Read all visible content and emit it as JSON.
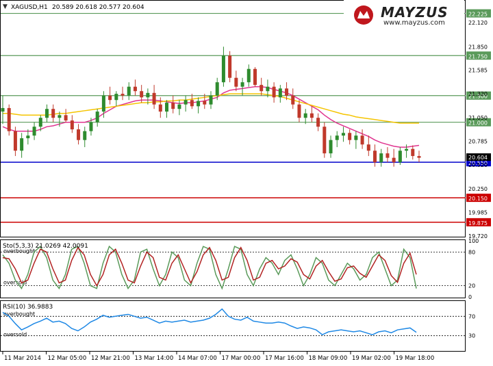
{
  "symbol_header": {
    "symbol": "XAGUSD,H1",
    "ohlc": "20.589 20.618 20.577 20.604"
  },
  "logo": {
    "brand": "MAYZUS",
    "url": "www.mayzus.com"
  },
  "colors": {
    "bull_candle": "#2e8b2e",
    "bear_candle": "#c0392b",
    "sma_fast": "#e0338f",
    "sma_slow": "#f5c400",
    "level_green": "#5a9a5a",
    "level_red": "#cc0000",
    "current_blue": "#0000cc",
    "stoch_main": "#5a9a5a",
    "stoch_signal": "#b22222",
    "rsi": "#1e88e5"
  },
  "chart_data": [
    {
      "type": "candlestick",
      "symbol": "XAGUSD",
      "timeframe": "H1",
      "ylim": [
        19.72,
        22.36
      ],
      "y_ticks": [
        "22.120",
        "21.850",
        "21.585",
        "21.320",
        "21.050",
        "20.785",
        "20.520",
        "20.250",
        "19.985",
        "19.720"
      ],
      "x_ticks": [
        "11 Mar 2014",
        "12 Mar 05:00",
        "12 Mar 21:00",
        "13 Mar 14:00",
        "14 Mar 07:00",
        "17 Mar 00:00",
        "17 Mar 16:00",
        "18 Mar 09:00",
        "19 Mar 02:00",
        "19 Mar 18:00"
      ],
      "horizontal_levels": [
        {
          "value": 22.225,
          "label": "22.225",
          "color": "green"
        },
        {
          "value": 21.75,
          "label": "21.750",
          "color": "green"
        },
        {
          "value": 21.3,
          "label": "21.300",
          "color": "green"
        },
        {
          "value": 21.0,
          "label": "21.000",
          "color": "green"
        },
        {
          "value": 20.15,
          "label": "20.150",
          "color": "red"
        },
        {
          "value": 19.875,
          "label": "19.875",
          "color": "red"
        }
      ],
      "current_price": {
        "value": 20.604,
        "label": "20.604"
      },
      "blue_line": {
        "value": 20.55,
        "label": "20.550"
      },
      "ohlc": [
        [
          21.12,
          21.3,
          20.98,
          21.16
        ],
        [
          21.16,
          21.2,
          20.85,
          20.9
        ],
        [
          20.9,
          20.95,
          20.62,
          20.68
        ],
        [
          20.68,
          20.88,
          20.6,
          20.82
        ],
        [
          20.82,
          20.92,
          20.75,
          20.85
        ],
        [
          20.85,
          21.0,
          20.8,
          20.95
        ],
        [
          20.95,
          21.08,
          20.9,
          21.05
        ],
        [
          21.05,
          21.2,
          21.0,
          21.15
        ],
        [
          21.15,
          21.2,
          21.0,
          21.05
        ],
        [
          21.05,
          21.12,
          20.95,
          21.08
        ],
        [
          21.08,
          21.15,
          21.0,
          21.02
        ],
        [
          21.02,
          21.08,
          20.88,
          20.92
        ],
        [
          20.92,
          20.98,
          20.75,
          20.8
        ],
        [
          20.8,
          20.95,
          20.72,
          20.9
        ],
        [
          20.9,
          21.05,
          20.85,
          21.0
        ],
        [
          21.0,
          21.15,
          20.95,
          21.12
        ],
        [
          21.12,
          21.35,
          21.05,
          21.3
        ],
        [
          21.3,
          21.4,
          21.2,
          21.25
        ],
        [
          21.25,
          21.35,
          21.18,
          21.32
        ],
        [
          21.32,
          21.4,
          21.25,
          21.3
        ],
        [
          21.3,
          21.45,
          21.25,
          21.4
        ],
        [
          21.4,
          21.48,
          21.3,
          21.35
        ],
        [
          21.35,
          21.42,
          21.22,
          21.28
        ],
        [
          21.28,
          21.38,
          21.2,
          21.33
        ],
        [
          21.33,
          21.42,
          21.15,
          21.2
        ],
        [
          21.2,
          21.28,
          21.05,
          21.12
        ],
        [
          21.12,
          21.25,
          21.05,
          21.22
        ],
        [
          21.22,
          21.3,
          21.1,
          21.15
        ],
        [
          21.15,
          21.25,
          21.08,
          21.2
        ],
        [
          21.2,
          21.3,
          21.12,
          21.25
        ],
        [
          21.25,
          21.32,
          21.15,
          21.18
        ],
        [
          21.18,
          21.28,
          21.1,
          21.24
        ],
        [
          21.24,
          21.32,
          21.15,
          21.2
        ],
        [
          21.2,
          21.35,
          21.15,
          21.3
        ],
        [
          21.3,
          21.5,
          21.25,
          21.45
        ],
        [
          21.45,
          21.85,
          21.4,
          21.75
        ],
        [
          21.75,
          21.8,
          21.45,
          21.5
        ],
        [
          21.5,
          21.58,
          21.35,
          21.4
        ],
        [
          21.4,
          21.5,
          21.3,
          21.45
        ],
        [
          21.45,
          21.65,
          21.4,
          21.6
        ],
        [
          21.6,
          21.62,
          21.4,
          21.42
        ],
        [
          21.42,
          21.5,
          21.3,
          21.35
        ],
        [
          21.35,
          21.48,
          21.28,
          21.4
        ],
        [
          21.4,
          21.45,
          21.22,
          21.28
        ],
        [
          21.28,
          21.42,
          21.22,
          21.38
        ],
        [
          21.38,
          21.45,
          21.25,
          21.3
        ],
        [
          21.3,
          21.38,
          21.15,
          21.2
        ],
        [
          21.2,
          21.25,
          21.0,
          21.05
        ],
        [
          21.05,
          21.15,
          20.98,
          21.1
        ],
        [
          21.1,
          21.18,
          21.0,
          21.05
        ],
        [
          21.05,
          21.1,
          20.9,
          20.95
        ],
        [
          20.95,
          21.0,
          20.6,
          20.65
        ],
        [
          20.65,
          20.85,
          20.6,
          20.8
        ],
        [
          20.8,
          20.9,
          20.72,
          20.85
        ],
        [
          20.85,
          20.95,
          20.78,
          20.88
        ],
        [
          20.88,
          20.92,
          20.75,
          20.8
        ],
        [
          20.8,
          20.9,
          20.7,
          20.85
        ],
        [
          20.85,
          20.92,
          20.7,
          20.75
        ],
        [
          20.75,
          20.85,
          20.62,
          20.68
        ],
        [
          20.68,
          20.75,
          20.5,
          20.55
        ],
        [
          20.55,
          20.7,
          20.5,
          20.65
        ],
        [
          20.65,
          20.72,
          20.55,
          20.6
        ],
        [
          20.6,
          20.7,
          20.5,
          20.55
        ],
        [
          20.55,
          20.72,
          20.52,
          20.68
        ],
        [
          20.68,
          20.75,
          20.6,
          20.7
        ],
        [
          20.7,
          20.74,
          20.58,
          20.62
        ],
        [
          20.62,
          20.68,
          20.55,
          20.6
        ]
      ],
      "sma_fast": [
        20.95,
        20.92,
        20.9,
        20.9,
        20.9,
        20.9,
        20.92,
        20.95,
        20.96,
        20.98,
        21.0,
        21.0,
        21.0,
        21.0,
        21.02,
        21.05,
        21.1,
        21.14,
        21.18,
        21.2,
        21.22,
        21.24,
        21.25,
        21.25,
        21.25,
        21.24,
        21.23,
        21.22,
        21.21,
        21.22,
        21.22,
        21.23,
        21.24,
        21.26,
        21.28,
        21.33,
        21.36,
        21.37,
        21.38,
        21.39,
        21.4,
        21.4,
        21.39,
        21.37,
        21.35,
        21.33,
        21.3,
        21.26,
        21.22,
        21.18,
        21.14,
        21.08,
        21.03,
        20.99,
        20.96,
        20.93,
        20.9,
        20.87,
        20.84,
        20.8,
        20.77,
        20.75,
        20.73,
        20.72,
        20.72,
        20.73,
        20.74
      ],
      "sma_slow": [
        21.1,
        21.1,
        21.09,
        21.08,
        21.08,
        21.08,
        21.08,
        21.08,
        21.09,
        21.1,
        21.1,
        21.11,
        21.12,
        21.13,
        21.14,
        21.15,
        21.16,
        21.17,
        21.18,
        21.19,
        21.2,
        21.21,
        21.22,
        21.22,
        21.23,
        21.23,
        21.24,
        21.24,
        21.25,
        21.25,
        21.26,
        21.27,
        21.28,
        21.29,
        21.3,
        21.31,
        21.32,
        21.32,
        21.32,
        21.32,
        21.32,
        21.32,
        21.31,
        21.3,
        21.29,
        21.27,
        21.25,
        21.23,
        21.21,
        21.19,
        21.17,
        21.15,
        21.13,
        21.11,
        21.09,
        21.08,
        21.06,
        21.05,
        21.04,
        21.03,
        21.02,
        21.01,
        21.0,
        20.99,
        20.99,
        20.99,
        20.99
      ]
    },
    {
      "type": "line",
      "indicator": "Stoch",
      "label": "Sto(5,3,3) 21.0269 42.0091",
      "ylim": [
        0,
        100
      ],
      "y_ticks": [
        "100",
        "80",
        "20",
        "0"
      ],
      "levels": [
        {
          "value": 80,
          "label": "overbought"
        },
        {
          "value": 20,
          "label": "oversold"
        }
      ],
      "main": [
        75,
        60,
        30,
        15,
        40,
        80,
        90,
        70,
        30,
        15,
        40,
        85,
        90,
        60,
        20,
        15,
        60,
        90,
        80,
        40,
        15,
        30,
        80,
        85,
        50,
        20,
        40,
        80,
        70,
        30,
        20,
        60,
        90,
        85,
        40,
        15,
        50,
        90,
        85,
        40,
        20,
        50,
        70,
        60,
        40,
        65,
        75,
        50,
        20,
        40,
        70,
        60,
        30,
        20,
        40,
        60,
        50,
        30,
        40,
        70,
        80,
        50,
        20,
        30,
        85,
        70,
        15
      ],
      "signal": [
        70,
        68,
        50,
        25,
        30,
        60,
        85,
        80,
        50,
        25,
        30,
        65,
        88,
        75,
        40,
        20,
        40,
        75,
        85,
        60,
        30,
        25,
        55,
        80,
        70,
        35,
        30,
        60,
        75,
        50,
        25,
        45,
        75,
        88,
        65,
        30,
        35,
        70,
        88,
        65,
        30,
        35,
        60,
        65,
        50,
        55,
        68,
        62,
        40,
        32,
        55,
        65,
        45,
        28,
        32,
        52,
        55,
        42,
        35,
        55,
        75,
        65,
        38,
        26,
        60,
        78,
        40
      ]
    },
    {
      "type": "line",
      "indicator": "RSI",
      "label": "RSI(10) 36.9883",
      "ylim": [
        0,
        100
      ],
      "y_ticks": [
        "70",
        "30"
      ],
      "levels": [
        {
          "value": 70,
          "label": "overbought"
        },
        {
          "value": 30,
          "label": "oversold"
        }
      ],
      "values": [
        78,
        70,
        55,
        42,
        48,
        55,
        60,
        66,
        58,
        60,
        55,
        45,
        40,
        48,
        58,
        64,
        72,
        68,
        70,
        72,
        74,
        70,
        66,
        68,
        62,
        56,
        60,
        58,
        60,
        62,
        58,
        60,
        62,
        66,
        74,
        85,
        70,
        64,
        62,
        68,
        60,
        58,
        56,
        56,
        58,
        56,
        50,
        45,
        48,
        46,
        42,
        32,
        38,
        40,
        42,
        40,
        38,
        40,
        36,
        32,
        38,
        40,
        36,
        42,
        44,
        46,
        37
      ]
    }
  ]
}
